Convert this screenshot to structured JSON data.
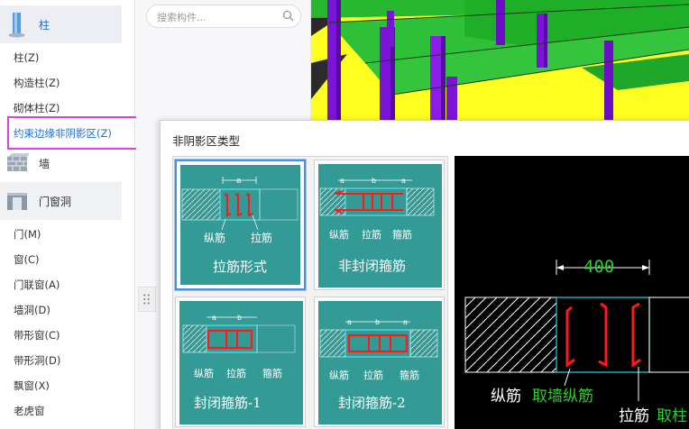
{
  "sidebar": {
    "categories": [
      {
        "label": "柱"
      },
      {
        "label": "墙"
      },
      {
        "label": "门窗洞"
      }
    ],
    "column_items": [
      "柱(Z)",
      "构造柱(Z)",
      "砌体柱(Z)",
      "约束边缘非阴影区(Z)"
    ],
    "opening_items": [
      "门(M)",
      "窗(C)",
      "门联窗(A)",
      "墙洞(D)",
      "带形窗(C)",
      "带形洞(D)",
      "飘窗(X)",
      "老虎窗"
    ]
  },
  "search": {
    "placeholder": "搜索构件..."
  },
  "dialog": {
    "title": "非阴影区类型",
    "options": [
      {
        "caption": "拉筋形式",
        "labels": [
          "纵筋",
          "拉筋"
        ],
        "dim": "a"
      },
      {
        "caption": "非封闭箍筋",
        "labels": [
          "纵筋",
          "拉筋",
          "箍筋"
        ],
        "dims": [
          "a",
          "b",
          "a"
        ]
      },
      {
        "caption": "封闭箍筋-1",
        "labels": [
          "纵筋",
          "拉筋",
          "箍筋"
        ],
        "dims": [
          "a",
          "b"
        ]
      },
      {
        "caption": "封闭箍筋-2",
        "labels": [
          "纵筋",
          "拉筋",
          "箍筋"
        ],
        "dims": [
          "a",
          "b",
          "a"
        ]
      }
    ],
    "preview": {
      "dimension": "400",
      "label1_white": "纵筋",
      "label1_green": "取墙纵筋",
      "label2_white": "拉筋",
      "label2_green": "取柱"
    }
  },
  "colors": {
    "teal": "#349a96",
    "rebar": "#e01010",
    "accent": "#1f6fd6",
    "highlight": "#e040e0"
  }
}
